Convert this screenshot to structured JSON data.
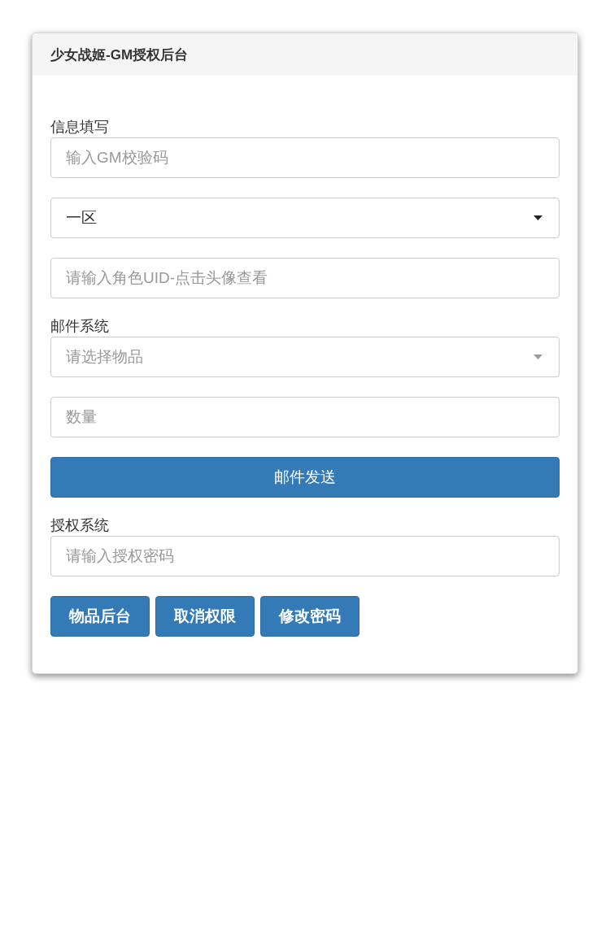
{
  "panel": {
    "title": "少女战姬-GM授权后台"
  },
  "sections": [
    {
      "label": "信息填写",
      "fields": [
        {
          "kind": "input",
          "placeholder": "输入GM校验码"
        },
        {
          "kind": "select",
          "value": "一区"
        },
        {
          "kind": "input",
          "placeholder": "请输入角色UID-点击头像查看"
        }
      ]
    },
    {
      "label": "邮件系统",
      "fields": [
        {
          "kind": "select",
          "placeholder": "请选择物品"
        },
        {
          "kind": "input",
          "placeholder": "数量"
        },
        {
          "kind": "button",
          "label": "邮件发送"
        }
      ]
    },
    {
      "label": "授权系统",
      "fields": [
        {
          "kind": "input",
          "placeholder": "请输入授权密码"
        },
        {
          "kind": "buttons",
          "labels": [
            "物品后台",
            "取消权限",
            "修改密码"
          ]
        }
      ]
    }
  ]
}
